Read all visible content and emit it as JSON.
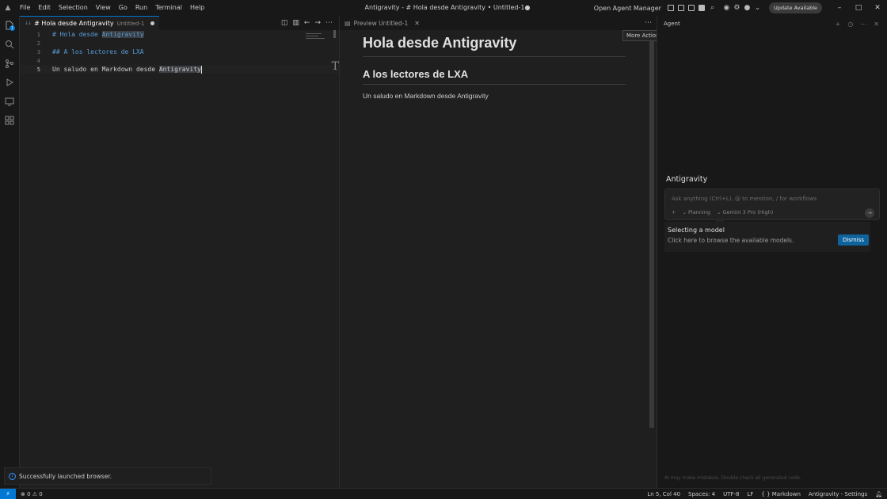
{
  "titlebar": {
    "menu": [
      "File",
      "Edit",
      "Selection",
      "View",
      "Go",
      "Run",
      "Terminal",
      "Help"
    ],
    "window_title": "Antigravity - # Hola desde Antigravity • Untitled-1●",
    "agent_manager": "Open Agent Manager",
    "update_label": "Update Available",
    "controls": {
      "minimize": "–",
      "maximize": "□",
      "close": "✕"
    }
  },
  "activity": {
    "badge": "1"
  },
  "editor": {
    "tab_title": "# Hola desde Antigravity",
    "tab_sub": "Untitled-1",
    "lines": [
      {
        "n": "1",
        "text": "# Hola desde Antigravity"
      },
      {
        "n": "2",
        "text": ""
      },
      {
        "n": "3",
        "text": "## A los lectores de LXA"
      },
      {
        "n": "4",
        "text": ""
      },
      {
        "n": "5",
        "text": "Un saludo en Markdown desde Antigravity"
      }
    ],
    "l1_prefix": "# Hola desde ",
    "l1_hl": "Antigravity",
    "l3": "## A los lectores de LXA",
    "l5_prefix": "Un saludo en Markdown desde ",
    "l5_hl": "Antigravity",
    "side_glyph": "T"
  },
  "preview": {
    "tab_title": "Preview Untitled-1",
    "h1": "Hola desde Antigravity",
    "h2": "A los lectores de LXA",
    "p": "Un saludo en Markdown desde Antigravity",
    "tooltip": "More Actions..."
  },
  "agent": {
    "header": "Agent",
    "name": "Antigravity",
    "placeholder": "Ask anything (Ctrl+L), @ to mention, / for workflows",
    "mode": "Planning",
    "model": "Gemini 3 Pro (High)",
    "callout_title": "Selecting a model",
    "callout_text": "Click here to browse the available models.",
    "dismiss": "Dismiss",
    "disclaimer": "AI may make mistakes. Double-check all generated code."
  },
  "notification": {
    "text": "Successfully launched browser."
  },
  "status": {
    "problems": "⊗ 0 ⚠ 0",
    "position": "Ln 5, Col 40",
    "spaces": "Spaces: 4",
    "encoding": "UTF-8",
    "eol": "LF",
    "language": "{ }  Markdown",
    "settings": "Antigravity - Settings"
  }
}
